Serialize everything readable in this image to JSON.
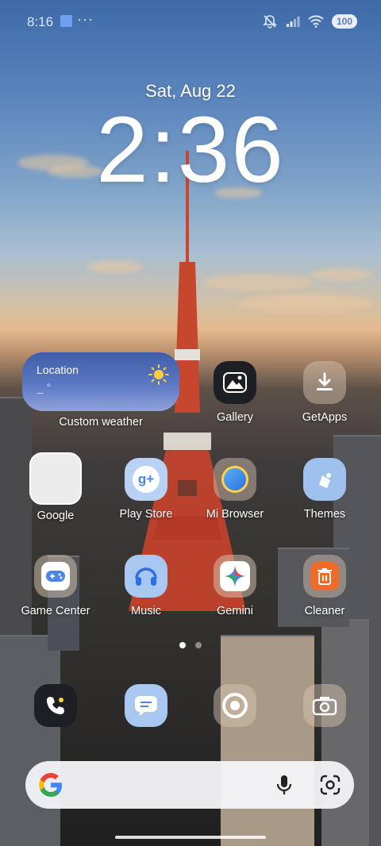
{
  "status_bar": {
    "time": "8:16",
    "notification_dots": "···",
    "battery_level": "100"
  },
  "lockscreen": {
    "date": "Sat, Aug 22",
    "clock": "2:36"
  },
  "weather_widget": {
    "location_label": "Location",
    "temperature": "_ °",
    "caption": "Custom weather"
  },
  "apps": [
    {
      "label": "Gallery"
    },
    {
      "label": "GetApps"
    },
    {
      "label": "Google"
    },
    {
      "label": "Play Store"
    },
    {
      "label": "Mi Browser"
    },
    {
      "label": "Themes"
    },
    {
      "label": "Game Center"
    },
    {
      "label": "Music"
    },
    {
      "label": "Gemini"
    },
    {
      "label": "Cleaner"
    }
  ],
  "dock": [
    "Phone",
    "Messaging",
    "Chrome",
    "Camera"
  ],
  "pager": {
    "pages": 2,
    "current": 1
  },
  "search_bar": {
    "logo": "G"
  },
  "colors": {
    "accent_blue": "#4a7ee0",
    "widget_blue": "#4f6dbb"
  }
}
